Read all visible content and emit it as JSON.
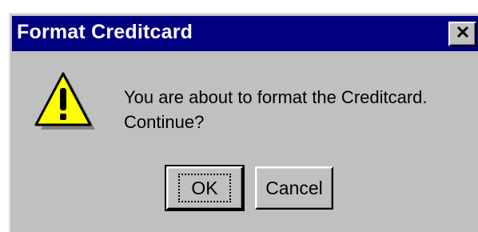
{
  "dialog": {
    "title": "Format Creditcard",
    "close_icon": "close-icon",
    "icon": "warning-icon",
    "message_line1": "You are about to format the Creditcard.",
    "message_line2": "Continue?"
  },
  "buttons": {
    "ok_label": "OK",
    "cancel_label": "Cancel"
  },
  "colors": {
    "titlebar": "#000080",
    "face": "#c0c0c0",
    "warning_fill": "#ffff00"
  }
}
